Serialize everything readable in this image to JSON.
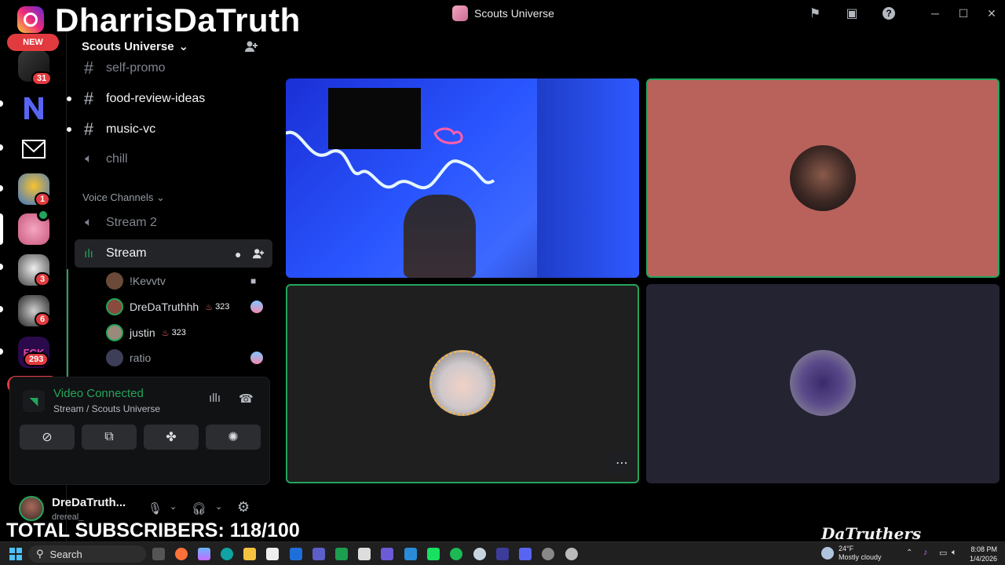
{
  "overlay": {
    "handle": "DharrisDaTruth",
    "subscribers": "TOTAL SUBSCRIBERS: 118/100",
    "brand": "DaTruthers"
  },
  "titlebar": {
    "title": "Scouts Universe"
  },
  "rail": {
    "new_label": "NEW",
    "badges": [
      "31",
      "1",
      "3",
      "6",
      "293"
    ]
  },
  "sidebar": {
    "server_name": "Scouts Universe",
    "text_channels": [
      {
        "label": "self-promo"
      },
      {
        "label": "food-review-ideas"
      },
      {
        "label": "music-vc"
      },
      {
        "label": "chill"
      }
    ],
    "voice_category": "Voice Channels",
    "voice_channels": [
      {
        "label": "Stream 2"
      },
      {
        "label": "Stream"
      }
    ],
    "voice_users": [
      {
        "name": "!Kevvtv",
        "streak": ""
      },
      {
        "name": "DreDaTruthhh",
        "streak": "323"
      },
      {
        "name": "justin",
        "streak": "323"
      },
      {
        "name": "ratio",
        "streak": ""
      }
    ]
  },
  "voice_panel": {
    "status": "Video Connected",
    "location": "Stream / Scouts Universe"
  },
  "user_panel": {
    "name": "DreDaTruth...",
    "username": "drereal_"
  },
  "taskbar": {
    "search_label": "Search",
    "weather_temp": "24°F",
    "weather_desc": "Mostly cloudy",
    "time": "8:08 PM",
    "date": "1/4/2026"
  },
  "colors": {
    "accent_green": "#23a55a",
    "badge_red": "#e23b3f",
    "tile_salmon": "#b9625b",
    "tile_dark": "#1f1f1f",
    "tile_navy": "#232332"
  }
}
